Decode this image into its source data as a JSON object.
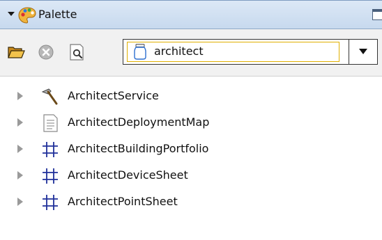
{
  "header": {
    "title": "Palette"
  },
  "toolbar": {
    "combo": {
      "selected": "architect"
    }
  },
  "tree": {
    "items": [
      {
        "label": "ArchitectService",
        "icon": "hammer-icon"
      },
      {
        "label": "ArchitectDeploymentMap",
        "icon": "document-icon"
      },
      {
        "label": "ArchitectBuildingPortfolio",
        "icon": "grid-icon"
      },
      {
        "label": "ArchitectDeviceSheet",
        "icon": "grid-icon"
      },
      {
        "label": "ArchitectPointSheet",
        "icon": "grid-icon"
      }
    ]
  },
  "colors": {
    "header_bg": "#c7d9ee",
    "toolbar_bg": "#f1f1f1",
    "combo_focus": "#e0b000"
  }
}
